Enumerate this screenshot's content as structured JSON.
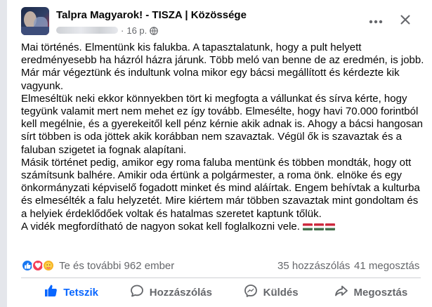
{
  "header": {
    "page_title": "Talpra Magyarok! - TISZA | Közössége",
    "time": "16 p.",
    "separator": "·"
  },
  "post": {
    "paragraphs": [
      "Mai történés. Elmentünk kis falukba. A tapasztalatunk, hogy a pult helyett eredményesebb ha házról házra járunk. Több meló van benne de az eredmén, is jobb.",
      "Már már végeztünk és indultunk volna mikor egy bácsi megállított és kérdezte kik vagyunk.",
      "Elmeséltük neki ekkor könnyekben tört ki megfogta a vállunkat és sírva kérte, hogy tegyünk valamit mert nem mehet ez így tovább. Elmesélte, hogy havi 70.000 forintból kell megélnie, és a gyerekeitől kell pénz kérnie akik adnak is.  Ahogy a bácsi hangosan sírt többen is oda jöttek akik korábban nem szavaztak. Végül ők is szavaztak és a faluban szigetet ia fognak alapítani.",
      "Másik történet pedig, amikor egy roma faluba mentünk és többen mondták, hogy ott számítsunk balhére. Amikir oda értünk a polgármester, a roma önk. elnöke és egy önkormányzati képviselő fogadott minket és mind aláírtak. Engem behívtak a kulturba és elmesélték a falu helyzetét. Mire kiértem már többen szavaztak mint gondoltam és a helyiek érdeklődőek voltak és hatalmas szeretet kaptunk tőlük.",
      "A vidék megfordítható de nagyon sokat kell foglalkozni vele."
    ]
  },
  "stats": {
    "reaction_summary": "Te és további 962 ember",
    "comments": "35 hozzászólás",
    "shares": "41 megosztás"
  },
  "actions": {
    "like": "Tetszik",
    "comment": "Hozzászólás",
    "send": "Küldés",
    "share": "Megosztás"
  },
  "icons": {
    "more": "more-icon",
    "close": "close-icon",
    "audience": "globe-icon",
    "like": "thumbs-up-icon",
    "comment": "comment-icon",
    "send": "messenger-icon",
    "share": "share-icon",
    "flag": "hungarian-flag-emoji"
  },
  "colors": {
    "accent": "#0866ff",
    "muted": "#65676b",
    "text": "#050505",
    "like_reaction": "#1877f2",
    "love_reaction": "#f33e58",
    "care_reaction": "#f7b125"
  }
}
